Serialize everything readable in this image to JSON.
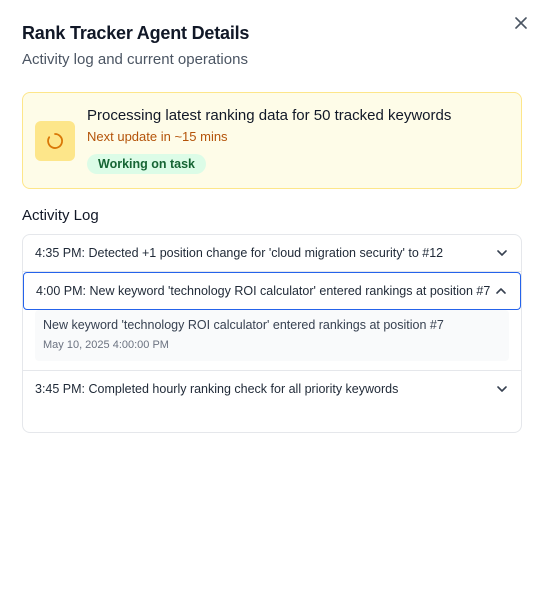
{
  "modal": {
    "title": "Rank Tracker Agent Details",
    "subtitle": "Activity log and current operations"
  },
  "status": {
    "icon": "spinner-icon",
    "heading": "Processing latest ranking data for 50 tracked keywords",
    "next_update": "Next update in ~15 mins",
    "badge": "Working on task"
  },
  "activity_log": {
    "title": "Activity Log",
    "items": [
      {
        "header": "4:35 PM: Detected +1 position change for 'cloud migration security' to #12",
        "expanded": false
      },
      {
        "header": "4:00 PM: New keyword 'technology ROI calculator' entered rankings at position #7",
        "expanded": true,
        "detail_message": "New keyword 'technology ROI calculator' entered rankings at position #7",
        "detail_timestamp": "May 10, 2025 4:00:00 PM"
      },
      {
        "header": "3:45 PM: Completed hourly ranking check for all priority keywords",
        "expanded": false
      }
    ]
  },
  "colors": {
    "status_bg": "#fefce8",
    "status_border": "#fde68a",
    "accent_text": "#b45309",
    "badge_bg": "#dcfce7",
    "badge_text": "#166534",
    "focus": "#2563eb"
  }
}
